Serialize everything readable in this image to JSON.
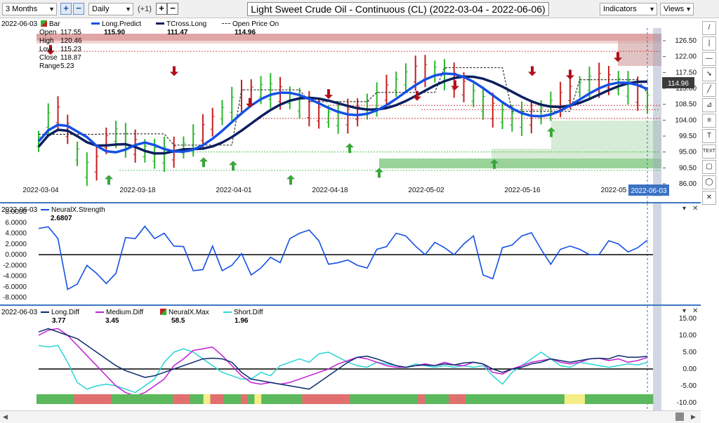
{
  "toolbar": {
    "period_select": "3 Months",
    "add_button": "+",
    "remove_button": "−",
    "interval_select": "Daily",
    "offset_label": "(+1)",
    "zoom_in_button": "+",
    "zoom_out_button": "−",
    "title": "Light Sweet Crude Oil - Continuous (CL) (2022-03-04 - 2022-06-06)",
    "indicators_button": "Indicators",
    "views_button": "Views"
  },
  "right_tools": [
    "/",
    "|",
    "—",
    "➘",
    "╱",
    "⊿",
    "≡",
    "T",
    "TEXT",
    "▢",
    "◯",
    "✕"
  ],
  "price_pane": {
    "date": "2022-06-03",
    "legend": {
      "bar_label": "Bar",
      "long_predict_label": "Long.Predict",
      "long_predict_value": "115.90",
      "tcross_label": "TCross.Long",
      "tcross_value": "111.47",
      "open_price_label": "Open Price On",
      "open_price_value": "114.96",
      "ohlc": [
        {
          "label": "Open",
          "value": "117.55"
        },
        {
          "label": "High",
          "value": "120.46"
        },
        {
          "label": "Low",
          "value": "115.23"
        },
        {
          "label": "Close",
          "value": "118.87"
        },
        {
          "label": "Range",
          "value": "5.23"
        }
      ]
    },
    "y_ticks": [
      "126.50",
      "122.00",
      "117.50",
      "113.00",
      "108.50",
      "104.00",
      "99.50",
      "95.00",
      "90.50",
      "86.00"
    ],
    "x_ticks": [
      "2022-03-04",
      "2022-03-18",
      "2022-04-01",
      "2022-04-18",
      "2022-05-02",
      "2022-05-16",
      "2022-05"
    ],
    "current_date_tag": "2022-06-03",
    "current_price_tag": "114.96",
    "colors": {
      "up": "#2bb52b",
      "down": "#c81e1e",
      "long_predict": "#1450e6",
      "tcross": "#0a1f5e"
    }
  },
  "neural_pane": {
    "date": "2022-06-03",
    "label": "NeuralX.Strength",
    "value": "2.6807",
    "y_ticks": [
      "8.0000",
      "6.0000",
      "4.0000",
      "2.0000",
      "0.0000",
      "-2.0000",
      "-4.0000",
      "-6.0000",
      "-8.0000"
    ],
    "series": [
      4.9,
      5.2,
      3.0,
      -6.5,
      -5.5,
      -2.0,
      -3.5,
      -5.4,
      -3.5,
      3.2,
      3.0,
      5.3,
      3.0,
      4.0,
      1.6,
      1.5,
      -3.0,
      -2.8,
      1.6,
      -3.0,
      -2.0,
      0.2,
      -3.8,
      -2.5,
      -0.5,
      -1.5,
      3.0,
      4.0,
      4.6,
      2.6,
      -1.8,
      -1.5,
      -1.0,
      -2.0,
      -2.5,
      1.0,
      1.5,
      4.0,
      3.5,
      1.6,
      0.0,
      2.3,
      1.3,
      0.0,
      2.0,
      3.5,
      -3.8,
      -4.5,
      1.3,
      1.8,
      3.5,
      4.1,
      1.0,
      -1.8,
      1.0,
      1.6,
      1.0,
      0.0,
      0.0,
      2.6,
      2.0,
      0.5,
      1.3,
      2.7
    ]
  },
  "diff_pane": {
    "date": "2022-06-03",
    "legend": [
      {
        "label": "Long.Diff",
        "value": "3.77"
      },
      {
        "label": "Medium.Diff",
        "value": "3.45"
      },
      {
        "label": "NeuralX.Max",
        "value": "58.5"
      },
      {
        "label": "Short.Diff",
        "value": "1.96"
      }
    ],
    "y_ticks": [
      "15.00",
      "10.00",
      "5.00",
      "0.00",
      "-5.00",
      "-10.00"
    ],
    "long_diff": [
      11,
      12,
      11,
      10,
      9,
      7,
      5,
      3,
      1,
      -0.5,
      -1.5,
      -2.5,
      -2,
      -1,
      0,
      1,
      2,
      3,
      3.2,
      3,
      2,
      -1,
      -3,
      -3.5,
      -4,
      -4.5,
      -5,
      -5.5,
      -6,
      -4,
      -2,
      0,
      2,
      3.5,
      3.8,
      3,
      2,
      1,
      0.5,
      1,
      1.2,
      1,
      1.5,
      1.2,
      1.8,
      2,
      1.5,
      0,
      -1,
      0,
      0.5,
      1.5,
      2,
      3,
      2.5,
      2,
      2.5,
      3,
      3.2,
      3,
      4,
      3.5,
      3.5,
      3.77
    ],
    "medium_diff": [
      10,
      11.5,
      12,
      10,
      7,
      4,
      1,
      -2,
      -5,
      -7,
      -8,
      -7,
      -5,
      -3,
      1,
      3,
      5.5,
      6,
      6.5,
      4,
      1,
      -2,
      -4,
      -4.5,
      -4,
      -4.5,
      -4,
      -3,
      -2,
      -1,
      0,
      1.5,
      2.5,
      3.5,
      3,
      2,
      1,
      0.5,
      0.5,
      1,
      1.5,
      1,
      2,
      1.2,
      1,
      2,
      1.5,
      -1,
      -1.5,
      0,
      1,
      2,
      2.5,
      3,
      2,
      1.5,
      2,
      3,
      3.2,
      2.5,
      3,
      2,
      2.5,
      3.45
    ],
    "short_diff": [
      7,
      6.5,
      7,
      2,
      -4,
      -6,
      -5,
      -4.5,
      -5,
      -6,
      -7,
      -5,
      -3,
      2,
      5,
      6,
      5,
      3,
      1,
      -1,
      -2,
      -3,
      -3,
      -1,
      -2,
      1,
      2,
      3,
      2,
      4.5,
      5,
      3.5,
      2,
      1,
      0.5,
      2,
      1.5,
      1,
      0.5,
      1.5,
      1,
      0.5,
      1,
      0.5,
      1,
      0.5,
      1,
      -2,
      -4.5,
      -1,
      1,
      3,
      5,
      3,
      1,
      0.5,
      2,
      1.5,
      1,
      0.5,
      1,
      1.5,
      1.2,
      1.96
    ],
    "max_bar_colors": [
      "g",
      "g",
      "g",
      "g",
      "g",
      "g",
      "g",
      "g",
      "g",
      "g",
      "g",
      "r",
      "r",
      "r",
      "r",
      "r",
      "r",
      "r",
      "r",
      "r",
      "r",
      "r",
      "g",
      "g",
      "g",
      "g",
      "g",
      "g",
      "g",
      "g",
      "g",
      "g",
      "g",
      "g",
      "g",
      "g",
      "g",
      "g",
      "g",
      "g",
      "r",
      "r",
      "r",
      "r",
      "r",
      "g",
      "g",
      "g",
      "g",
      "y",
      "y",
      "r",
      "r",
      "r",
      "r",
      "g",
      "g",
      "g",
      "g",
      "g",
      "r",
      "r",
      "g",
      "g",
      "y",
      "y",
      "g",
      "g",
      "g",
      "g",
      "g",
      "g",
      "g",
      "g",
      "g",
      "g",
      "g",
      "g",
      "r",
      "r",
      "r",
      "r",
      "r",
      "r",
      "r",
      "r",
      "r",
      "r",
      "r",
      "r",
      "r",
      "r",
      "g",
      "g",
      "g",
      "g",
      "g",
      "g",
      "g",
      "g",
      "g",
      "g",
      "g",
      "g",
      "g",
      "g",
      "g",
      "g",
      "g",
      "g",
      "g",
      "g",
      "r",
      "r",
      "g",
      "g",
      "g",
      "g",
      "g",
      "g",
      "g",
      "r",
      "r",
      "r",
      "r",
      "r",
      "g",
      "g",
      "g",
      "g",
      "g",
      "g",
      "g",
      "g",
      "g",
      "g",
      "g",
      "g",
      "g",
      "g",
      "g",
      "g",
      "g",
      "g",
      "g",
      "g",
      "g",
      "g",
      "g",
      "g",
      "g",
      "g",
      "g",
      "g",
      "g",
      "y",
      "y",
      "y",
      "y",
      "y",
      "y",
      "g",
      "g",
      "g",
      "g",
      "g",
      "g",
      "g",
      "g",
      "g",
      "g",
      "g",
      "g",
      "g",
      "g",
      "g",
      "g",
      "g",
      "g",
      "g",
      "g"
    ],
    "colors": {
      "long": "#0a2a6e",
      "medium": "#c21ed6",
      "short": "#2ad4d4",
      "max_green": "#5cb85c",
      "max_red": "#e07070",
      "max_yellow": "#f5ee88"
    }
  }
}
